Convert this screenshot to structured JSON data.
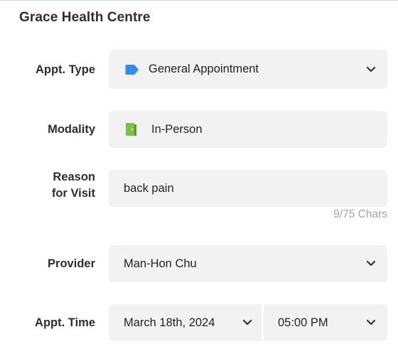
{
  "header": {
    "title": "Grace Health Centre"
  },
  "form": {
    "appt_type": {
      "label": "Appt. Type",
      "value": "General Appointment",
      "icon": "tag-icon",
      "icon_color": "#2e8ff0"
    },
    "modality": {
      "label": "Modality",
      "value": "In-Person",
      "icon": "door-icon",
      "icon_color": "#7cc142"
    },
    "reason": {
      "label_line1": "Reason",
      "label_line2": "for Visit",
      "value": "back pain",
      "counter": "9/75 Chars"
    },
    "provider": {
      "label": "Provider",
      "value": "Man-Hon Chu"
    },
    "appt_time": {
      "label": "Appt. Time",
      "date": "March 18th, 2024",
      "time": "05:00 PM"
    }
  },
  "colors": {
    "field_bg": "#f2f2f2",
    "counter_text": "#a4a4a4"
  }
}
